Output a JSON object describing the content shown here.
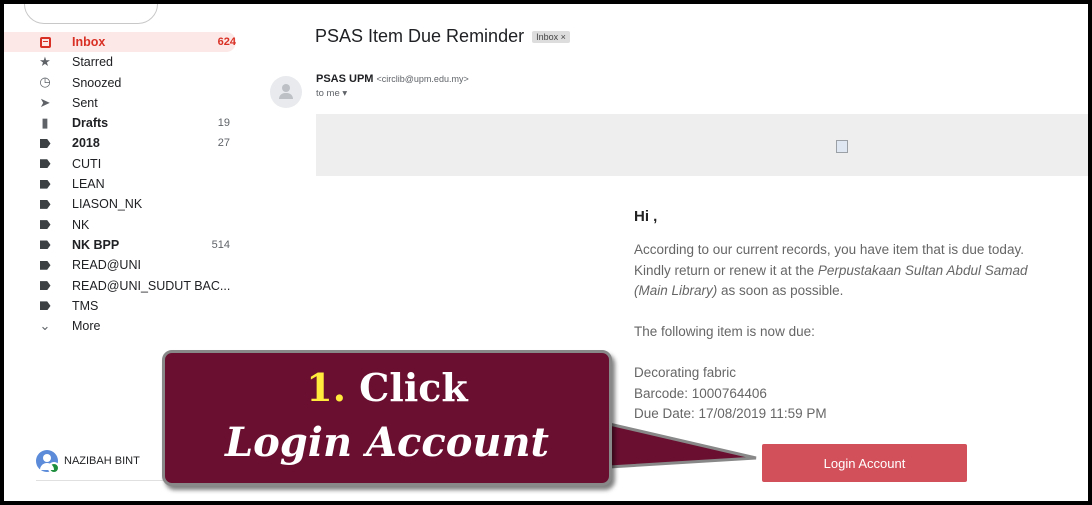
{
  "sidebar": {
    "items": [
      {
        "label": "Inbox",
        "count": "624",
        "icon": "inbox-icon"
      },
      {
        "label": "Starred",
        "count": "",
        "icon": "star-icon"
      },
      {
        "label": "Snoozed",
        "count": "",
        "icon": "clock-icon"
      },
      {
        "label": "Sent",
        "count": "",
        "icon": "send-icon"
      },
      {
        "label": "Drafts",
        "count": "19",
        "icon": "draft-icon"
      },
      {
        "label": "2018",
        "count": "27",
        "icon": "label-icon"
      },
      {
        "label": "CUTI",
        "count": "",
        "icon": "label-icon"
      },
      {
        "label": "LEAN",
        "count": "",
        "icon": "label-icon"
      },
      {
        "label": "LIASON_NK",
        "count": "",
        "icon": "label-icon"
      },
      {
        "label": "NK",
        "count": "",
        "icon": "label-icon"
      },
      {
        "label": "NK BPP",
        "count": "514",
        "icon": "label-icon"
      },
      {
        "label": "READ@UNI",
        "count": "",
        "icon": "label-icon"
      },
      {
        "label": "READ@UNI_SUDUT BAC...",
        "count": "",
        "icon": "label-icon"
      },
      {
        "label": "TMS",
        "count": "",
        "icon": "label-icon"
      },
      {
        "label": "More",
        "count": "",
        "icon": "chevron-down-icon"
      }
    ],
    "user_name": "NAZIBAH BINT"
  },
  "email": {
    "subject": "PSAS Item Due Reminder",
    "label_chip": "Inbox ×",
    "sender_name": "PSAS UPM",
    "sender_email": "<circlib@upm.edu.my>",
    "to": "to me ▾",
    "greeting": "Hi ,",
    "para1_line1": "According to our current records, you have item that is due today.",
    "para1_line2_a": "Kindly return or renew it at the ",
    "para1_line2_b": "Perpustakaan Sultan Abdul Samad",
    "para1_line3_a": "(Main Library)",
    "para1_line3_b": " as soon as possible.",
    "para2": "The following item is now due:",
    "item_title": "Decorating fabric",
    "barcode": "Barcode: 1000764406",
    "due_date": "Due Date: 17/08/2019 11:59 PM",
    "button_label": "Login Account"
  },
  "callout": {
    "step_num": "1.",
    "step_word": " Click",
    "step_target": "Login Account",
    "fill_color": "#6a0f30",
    "number_color": "#ffeb3b"
  }
}
